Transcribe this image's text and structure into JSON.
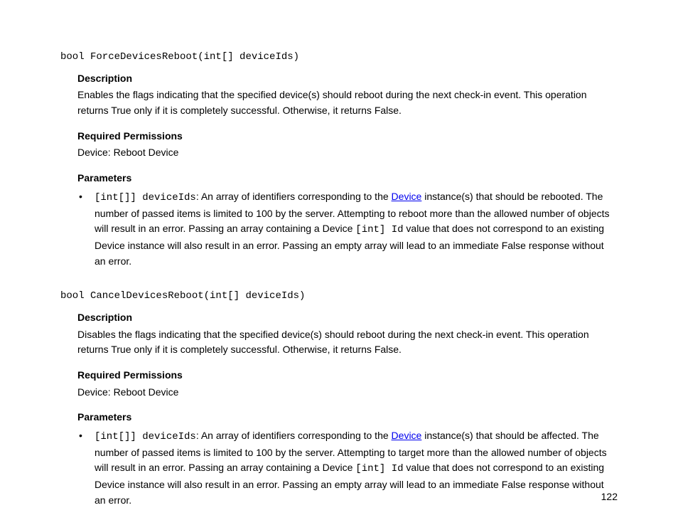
{
  "methods": [
    {
      "signature": "bool ForceDevicesReboot(int[] deviceIds)",
      "labels": {
        "description": "Description",
        "permissions": "Required Permissions",
        "parameters": "Parameters"
      },
      "description": "Enables the flags indicating that the specified device(s) should reboot during the next check-in event. This operation returns True only if it is completely successful. Otherwise, it returns False.",
      "permissions": "Device: Reboot Device",
      "param": {
        "type": "[int[]] deviceIds",
        "pre_link": ": An array of identifiers corresponding to the ",
        "link": "Device",
        "post_link_a": " instance(s) that should be rebooted. The number of passed items is limited to 100 by the server. Attempting to reboot more than the allowed number of objects will result in an error. Passing an array containing a Device ",
        "inline_code": "[int] Id",
        "post_link_b": " value that does not correspond to an existing Device instance will also result in an error. Passing an empty array will lead to an immediate False response without an error."
      }
    },
    {
      "signature": "bool CancelDevicesReboot(int[] deviceIds)",
      "labels": {
        "description": "Description",
        "permissions": "Required Permissions",
        "parameters": "Parameters"
      },
      "description": "Disables the flags indicating that the specified device(s) should reboot during the next check-in event. This operation returns True only if it is completely successful. Otherwise, it returns False.",
      "permissions": "Device: Reboot Device",
      "param": {
        "type": "[int[]] deviceIds",
        "pre_link": ": An array of identifiers corresponding to the ",
        "link": "Device",
        "post_link_a": " instance(s) that should be affected. The number of passed items is limited to 100 by the server. Attempting to target more than the allowed number of objects will result in an error. Passing an array containing a Device ",
        "inline_code": "[int] Id",
        "post_link_b": " value that does not correspond to an existing Device instance will also result in an error. Passing an empty array will lead to an immediate False response without an error."
      }
    }
  ],
  "page_number": "122"
}
